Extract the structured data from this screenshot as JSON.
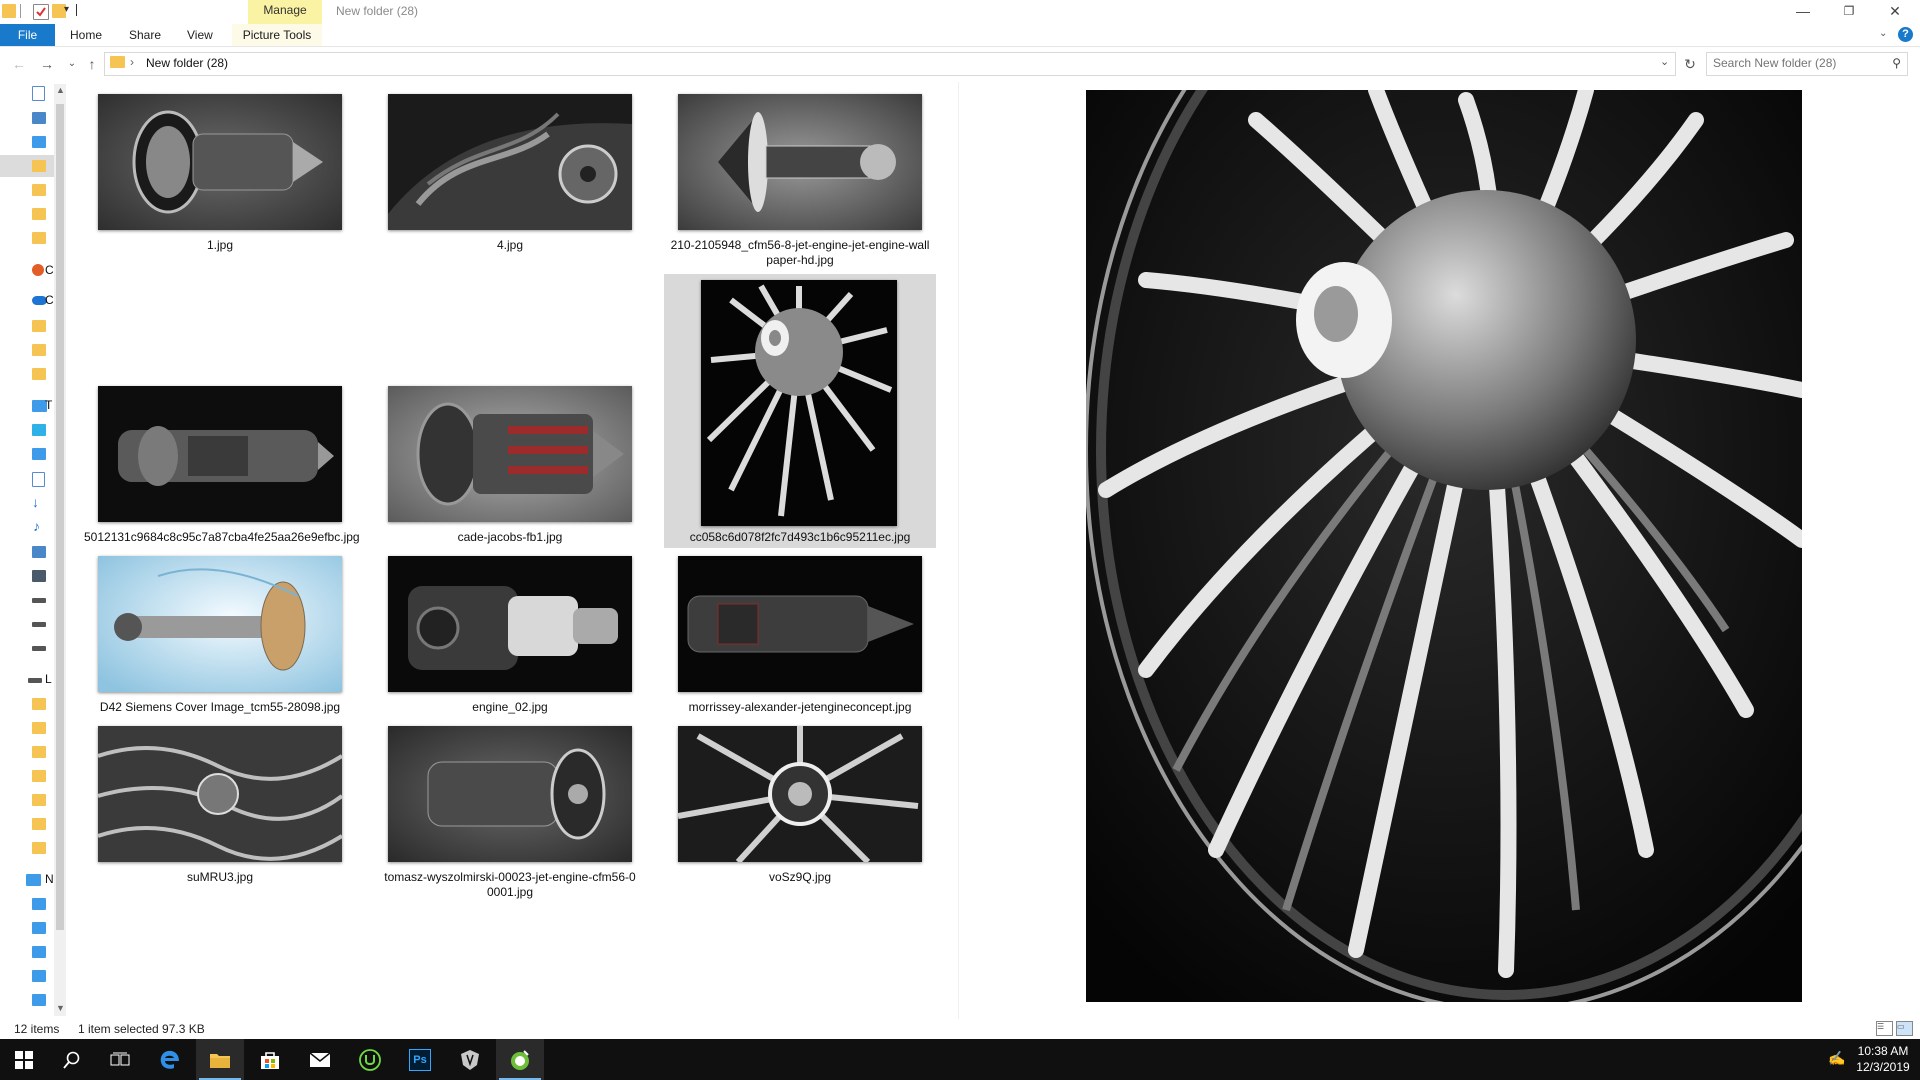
{
  "window": {
    "title": "New folder (28)",
    "manage_tab": "Manage",
    "controls": {
      "minimize": "—",
      "maximize": "❐",
      "close": "✕"
    }
  },
  "ribbon": {
    "file": "File",
    "tabs": [
      "Home",
      "Share",
      "View"
    ],
    "picture_tools": "Picture Tools",
    "help": "?"
  },
  "address": {
    "path": "New folder (28)",
    "search_placeholder": "Search New folder (28)"
  },
  "nav_fragments": [
    "C",
    "C",
    "T",
    "L",
    "N"
  ],
  "files": [
    {
      "name": "1.jpg"
    },
    {
      "name": "4.jpg"
    },
    {
      "name": "210-2105948_cfm56-8-jet-engine-jet-engine-wall",
      "name2": "paper-hd.jpg"
    },
    {
      "name": "5012131c9684c8c95c7a87cba4fe25aa26e9efbc.jpg"
    },
    {
      "name": "cade-jacobs-fb1.jpg"
    },
    {
      "name": "cc058c6d078f2fc7d493c1b6c95211ec.jpg"
    },
    {
      "name": "D42 Siemens Cover Image_tcm55-28098.jpg"
    },
    {
      "name": "engine_02.jpg"
    },
    {
      "name": "morrissey-alexander-jetengineconcept.jpg"
    },
    {
      "name": "suMRU3.jpg"
    },
    {
      "name": "tomasz-wyszolmirski-00023-jet-engine-cfm56-0",
      "name2": "0001.jpg"
    },
    {
      "name": "voSz9Q.jpg"
    }
  ],
  "status": {
    "item_count": "12 items",
    "selection": "1 item selected  97.3 KB"
  },
  "taskbar": {
    "apps": [
      "start-icon",
      "search-icon",
      "task-view-icon",
      "edge-icon",
      "file-explorer-icon",
      "store-icon",
      "mail-icon",
      "upwork-icon",
      "photoshop-icon",
      "game-app-icon",
      "green-app-icon"
    ],
    "photoshop_label": "Ps",
    "time": "10:38 AM",
    "date": "12/3/2019"
  },
  "colors": {
    "accent": "#1979ca",
    "manage_tab": "#fbf3a4",
    "folder": "#f5c453",
    "taskbar": "#101010"
  }
}
